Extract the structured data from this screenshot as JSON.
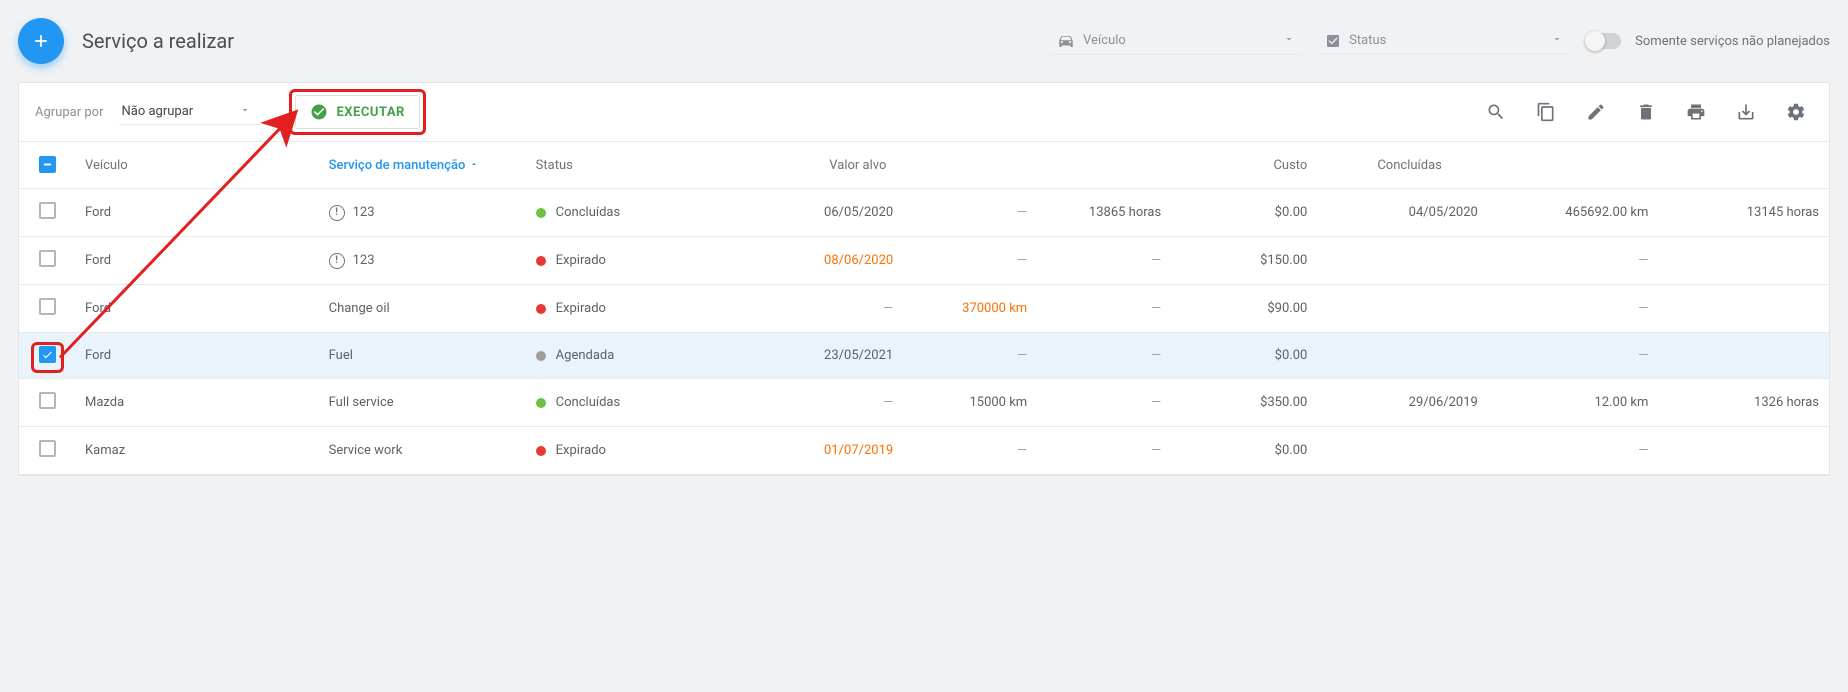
{
  "header": {
    "page_title": "Serviço a realizar",
    "vehicle_filter_placeholder": "Veículo",
    "status_filter_placeholder": "Status",
    "unplanned_only_label": "Somente serviços não planejados"
  },
  "toolbar": {
    "group_by_label": "Agrupar por",
    "group_by_value": "Não agrupar",
    "execute_label": "EXECUTAR"
  },
  "table": {
    "columns": {
      "vehicle": "Veículo",
      "service": "Serviço de manutenção",
      "status": "Status",
      "target": "Valor alvo",
      "cost": "Custo",
      "completed": "Concluídas"
    },
    "rows": [
      {
        "checked": false,
        "vehicle": "Ford",
        "service": "123",
        "warn": true,
        "status_color": "green",
        "status_text": "Concluídas",
        "target_a": "06/05/2020",
        "target_a_red": false,
        "target_b": "—",
        "target_c": "13865 horas",
        "cost": "$0.00",
        "done_a": "04/05/2020",
        "done_b": "465692.00 km",
        "done_c": "13145 horas"
      },
      {
        "checked": false,
        "vehicle": "Ford",
        "service": "123",
        "warn": true,
        "status_color": "red",
        "status_text": "Expirado",
        "target_a": "08/06/2020",
        "target_a_red": true,
        "target_b": "—",
        "target_c": "—",
        "cost": "$150.00",
        "done_a": "",
        "done_b": "—",
        "done_c": ""
      },
      {
        "checked": false,
        "vehicle": "Ford",
        "service": "Change oil",
        "warn": false,
        "status_color": "red",
        "status_text": "Expirado",
        "target_a": "—",
        "target_a_red": false,
        "target_b": "370000 km",
        "target_b_red": true,
        "target_c": "—",
        "cost": "$90.00",
        "done_a": "",
        "done_b": "—",
        "done_c": ""
      },
      {
        "checked": true,
        "vehicle": "Ford",
        "service": "Fuel",
        "warn": false,
        "status_color": "grey",
        "status_text": "Agendada",
        "target_a": "23/05/2021",
        "target_a_red": false,
        "target_b": "—",
        "target_c": "—",
        "cost": "$0.00",
        "done_a": "",
        "done_b": "—",
        "done_c": ""
      },
      {
        "checked": false,
        "vehicle": "Mazda",
        "service": "Full service",
        "warn": false,
        "status_color": "green",
        "status_text": "Concluídas",
        "target_a": "—",
        "target_a_red": false,
        "target_b": "15000 km",
        "target_c": "—",
        "cost": "$350.00",
        "done_a": "29/06/2019",
        "done_b": "12.00 km",
        "done_c": "1326 horas"
      },
      {
        "checked": false,
        "vehicle": "Kamaz",
        "service": "Service work",
        "warn": false,
        "status_color": "red",
        "status_text": "Expirado",
        "target_a": "01/07/2019",
        "target_a_red": true,
        "target_b": "—",
        "target_c": "—",
        "cost": "$0.00",
        "done_a": "",
        "done_b": "—",
        "done_c": ""
      }
    ]
  }
}
